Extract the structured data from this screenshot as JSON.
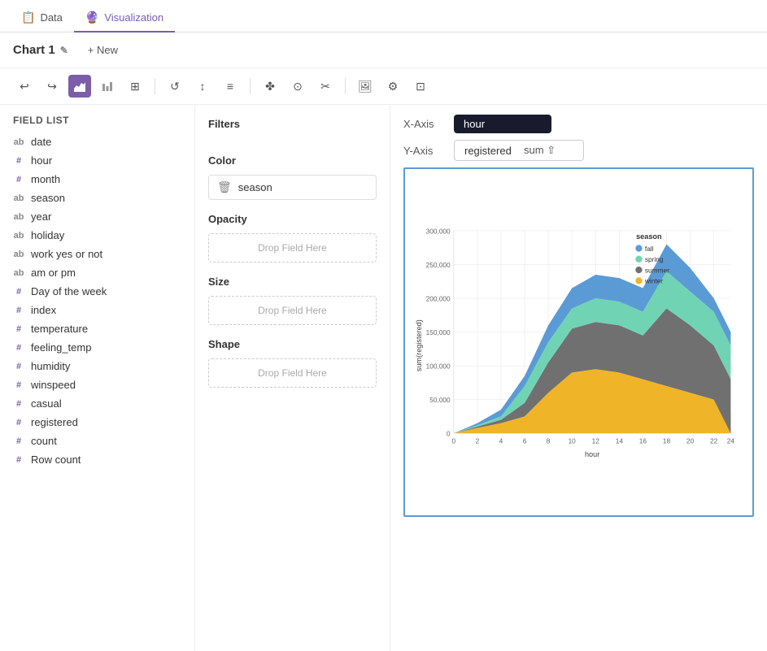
{
  "tabs": [
    {
      "id": "data",
      "label": "Data",
      "icon": "📋",
      "active": false
    },
    {
      "id": "visualization",
      "label": "Visualization",
      "icon": "🔮",
      "active": true
    }
  ],
  "chart_header": {
    "title": "Chart 1",
    "edit_icon": "✎",
    "new_label": "+ New"
  },
  "toolbar": {
    "buttons": [
      "↩",
      "↪",
      "■",
      "🔲",
      "⊞",
      "↺",
      "↕",
      "≡",
      "✤",
      "⊙",
      "✂",
      "🖼",
      "⊡"
    ]
  },
  "field_list": {
    "title": "Field List",
    "fields": [
      {
        "name": "date",
        "type": "string",
        "type_label": "ab"
      },
      {
        "name": "hour",
        "type": "number",
        "type_label": "#"
      },
      {
        "name": "month",
        "type": "number",
        "type_label": "#"
      },
      {
        "name": "season",
        "type": "string",
        "type_label": "ab"
      },
      {
        "name": "year",
        "type": "string",
        "type_label": "ab"
      },
      {
        "name": "holiday",
        "type": "string",
        "type_label": "ab"
      },
      {
        "name": "work yes or not",
        "type": "string",
        "type_label": "ab"
      },
      {
        "name": "am or pm",
        "type": "string",
        "type_label": "ab"
      },
      {
        "name": "Day of the week",
        "type": "number",
        "type_label": "#"
      },
      {
        "name": "index",
        "type": "number",
        "type_label": "#"
      },
      {
        "name": "temperature",
        "type": "number",
        "type_label": "#"
      },
      {
        "name": "feeling_temp",
        "type": "number",
        "type_label": "#"
      },
      {
        "name": "humidity",
        "type": "number",
        "type_label": "#"
      },
      {
        "name": "winspeed",
        "type": "number",
        "type_label": "#"
      },
      {
        "name": "casual",
        "type": "number",
        "type_label": "#"
      },
      {
        "name": "registered",
        "type": "number",
        "type_label": "#"
      },
      {
        "name": "count",
        "type": "number",
        "type_label": "#"
      },
      {
        "name": "Row count",
        "type": "number",
        "type_label": "#"
      }
    ]
  },
  "filters": {
    "title": "Filters"
  },
  "color": {
    "title": "Color",
    "value": "season"
  },
  "opacity": {
    "title": "Opacity",
    "placeholder": "Drop Field Here"
  },
  "size": {
    "title": "Size",
    "placeholder": "Drop Field Here"
  },
  "shape": {
    "title": "Shape",
    "placeholder": "Drop Field Here"
  },
  "xaxis": {
    "label": "X-Axis",
    "value": "hour"
  },
  "yaxis": {
    "label": "Y-Axis",
    "field": "registered",
    "agg": "sum"
  },
  "legend": {
    "title": "season",
    "items": [
      {
        "label": "fall",
        "color": "#5b9bd5"
      },
      {
        "label": "spring",
        "color": "#70d4b4"
      },
      {
        "label": "summer",
        "color": "#707070"
      },
      {
        "label": "winter",
        "color": "#f0b429"
      }
    ]
  },
  "chart": {
    "x_label": "hour",
    "y_label": "sum(registered)",
    "x_ticks": [
      "0",
      "2",
      "4",
      "6",
      "8",
      "10",
      "12",
      "14",
      "16",
      "18",
      "20",
      "22",
      "24"
    ],
    "y_ticks": [
      "0",
      "50,000",
      "100,000",
      "150,000",
      "200,000",
      "250,000",
      "300,000"
    ]
  }
}
